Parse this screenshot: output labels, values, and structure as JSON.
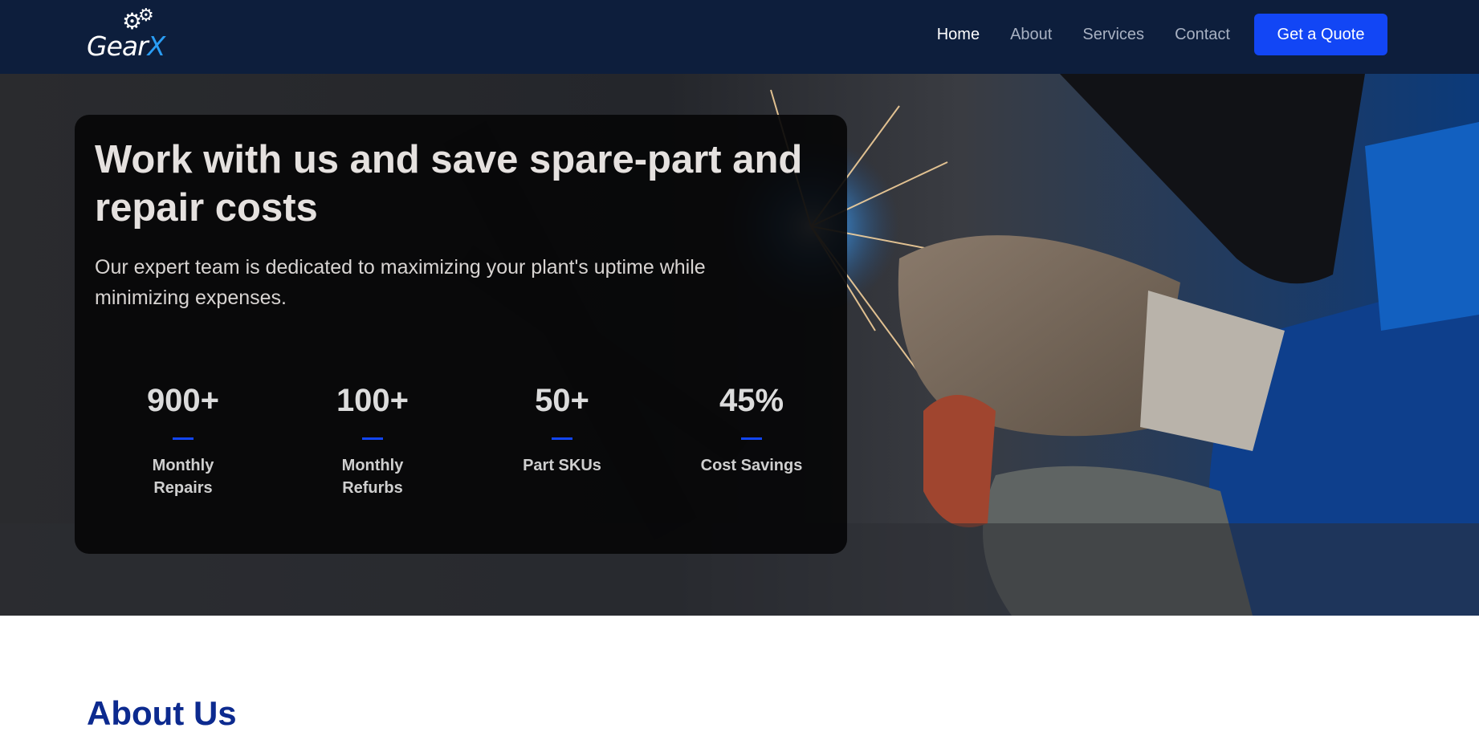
{
  "brand": {
    "name_part1": "Gear",
    "name_part2": "X"
  },
  "nav": {
    "items": [
      {
        "label": "Home",
        "active": true
      },
      {
        "label": "About",
        "active": false
      },
      {
        "label": "Services",
        "active": false
      },
      {
        "label": "Contact",
        "active": false
      }
    ],
    "cta_label": "Get a Quote"
  },
  "hero": {
    "title": "Work with us and save spare-part and repair costs",
    "subtitle": "Our expert team is dedicated to maximizing your plant's uptime while minimizing expenses.",
    "stats": [
      {
        "value": "900+",
        "label": "Monthly Repairs"
      },
      {
        "value": "100+",
        "label": "Monthly Refurbs"
      },
      {
        "value": "50+",
        "label": "Part SKUs"
      },
      {
        "value": "45%",
        "label": "Cost Savings"
      }
    ]
  },
  "about": {
    "title": "About Us"
  },
  "colors": {
    "header_bg": "#0d1e3c",
    "accent": "#1246f5",
    "about_title": "#0c2a8f",
    "logo_x": "#2a9df4"
  }
}
